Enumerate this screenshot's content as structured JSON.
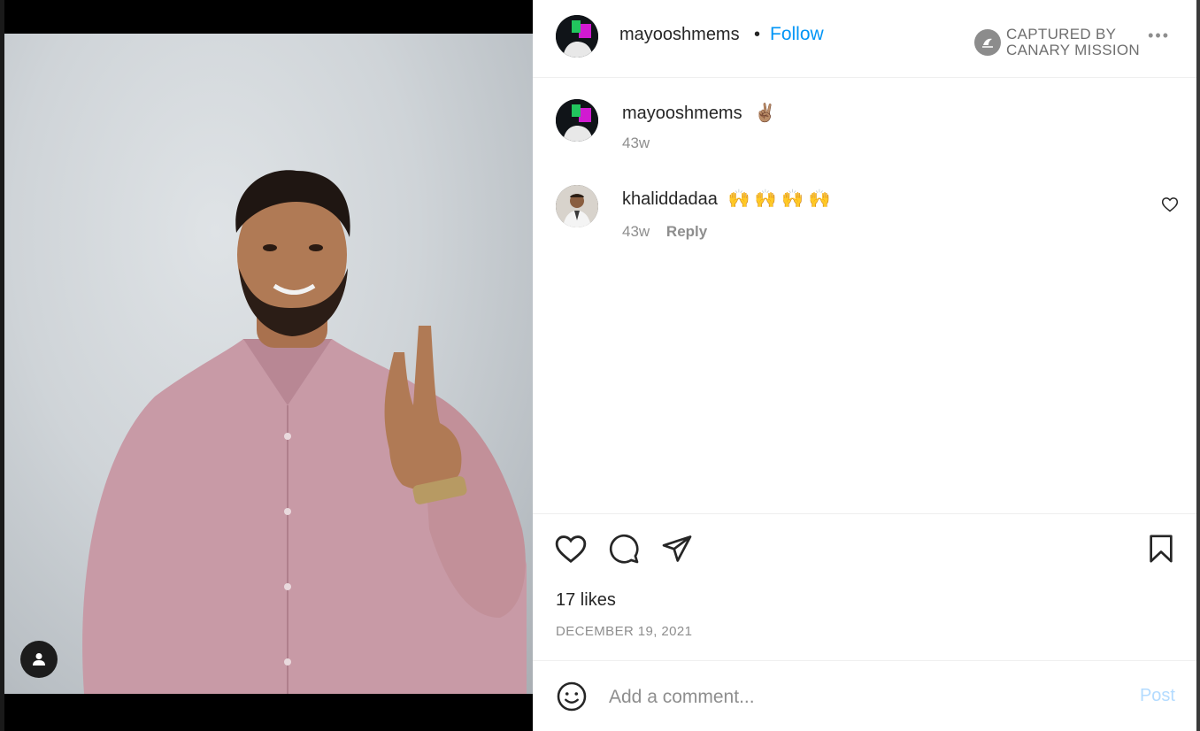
{
  "header": {
    "username": "mayooshmems",
    "separator": "•",
    "follow_label": "Follow",
    "captured_line1": "CAPTURED BY",
    "captured_line2": "CANARY MISSION",
    "more_icon": "more-dots-icon",
    "more_label": "•••"
  },
  "caption": {
    "username": "mayooshmems",
    "emoji": "✌🏽",
    "time": "43w"
  },
  "comments": [
    {
      "username": "khaliddadaa",
      "text": "🙌 🙌 🙌 🙌",
      "time": "43w",
      "reply_label": "Reply"
    }
  ],
  "post": {
    "likes": "17 likes",
    "date": "DECEMBER 19, 2021"
  },
  "compose": {
    "placeholder": "Add a comment...",
    "post_label": "Post"
  },
  "colors": {
    "accent": "#0095f6",
    "post_disabled": "#b3dbff",
    "muted_text": "#8e8e8e"
  },
  "icons": [
    "heart-icon",
    "comment-icon",
    "share-icon",
    "bookmark-icon",
    "emoji-icon",
    "user-tag-icon",
    "canary-mission-logo"
  ]
}
